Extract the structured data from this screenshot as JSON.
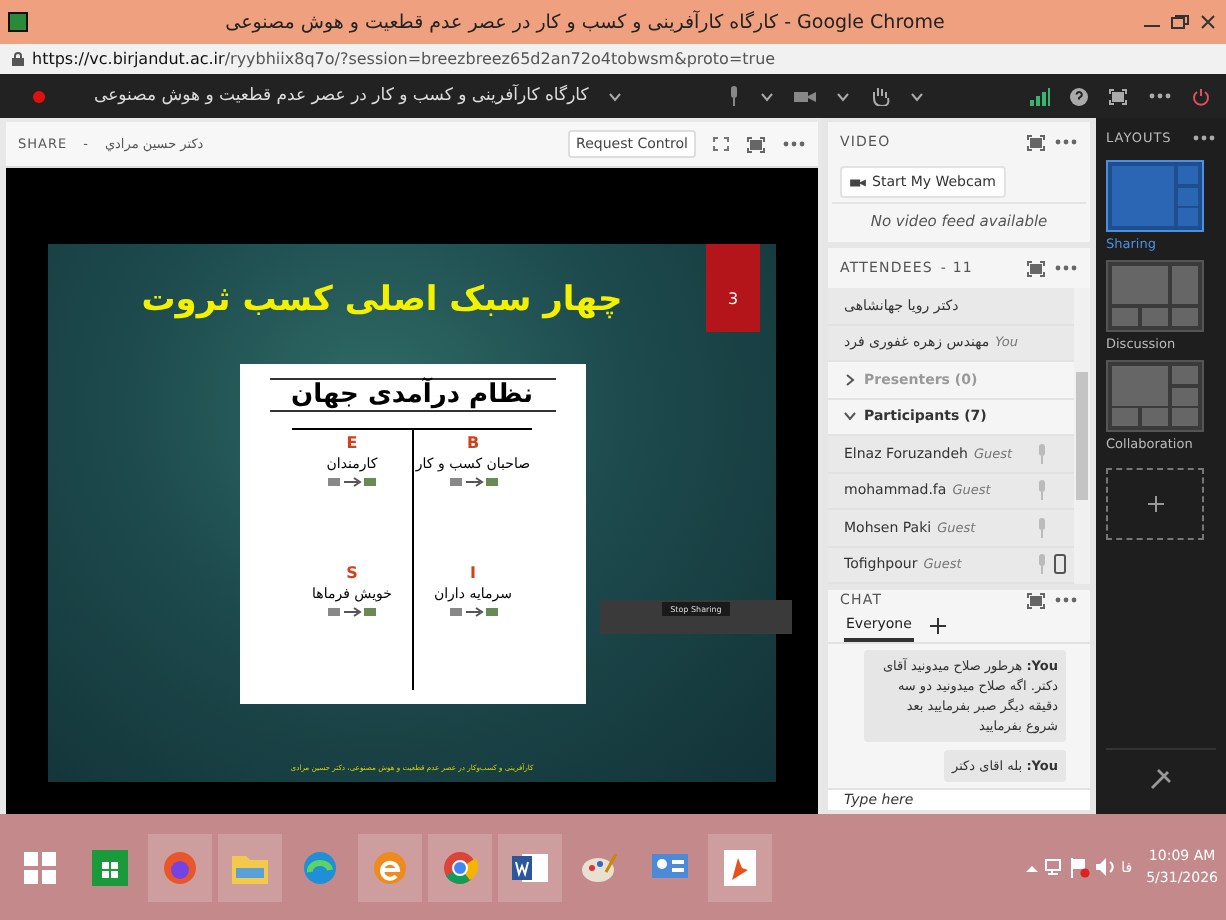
{
  "browser": {
    "title": "کارگاه کارآفرینی و کسب و کار در عصر عدم قطعیت و هوش مصنوعی - Google Chrome",
    "url_host": "https://vc.birjandut.ac.ir",
    "url_path": "/ryybhiix8q7o/?session=breezbreez65d2an72o4tobwsm&proto=true"
  },
  "toolbar": {
    "recording": true,
    "meeting_title": "کارگاه کارآفرینی و کسب و کار در عصر عدم قطعیت و هوش مصنوعی"
  },
  "share": {
    "label": "SHARE",
    "separator": "-",
    "presenter": "دکتر حسين مرادي",
    "request_control": "Request Control"
  },
  "slide": {
    "title": "چهار سبک اصلی کسب ثروت",
    "number": "3",
    "image_title": "نظام درآمدی جهان",
    "quadrants": [
      {
        "letter": "B",
        "label": "صاحبان کسب و کار"
      },
      {
        "letter": "E",
        "label": "کارمندان"
      },
      {
        "letter": "I",
        "label": "سرمایه داران"
      },
      {
        "letter": "S",
        "label": "خویش فرماها"
      }
    ],
    "footer": "کارآفرینی و کسب‌وکار  در عصر عدم قطعیت و هوش مصنوعی، دکتر حسین مرادی"
  },
  "stop_sharing": "Stop Sharing",
  "video": {
    "title": "VIDEO",
    "button": "Start My Webcam",
    "empty": "No video feed available"
  },
  "attendees": {
    "title": "ATTENDEES",
    "count": "- 11",
    "hosts": [
      {
        "name": "دکتر رویا جهانشاهی"
      },
      {
        "name": "مهندس زهره غفوری فرد",
        "tag": "You"
      }
    ],
    "groups": [
      {
        "label": "Presenters (0)",
        "expanded": false
      },
      {
        "label": "Participants (7)",
        "expanded": true,
        "members": [
          {
            "name": "Elnaz Foruzandeh",
            "role": "Guest",
            "mobile": false
          },
          {
            "name": "mohammad.fa",
            "role": "Guest",
            "mobile": false
          },
          {
            "name": "Mohsen Paki",
            "role": "Guest",
            "mobile": false
          },
          {
            "name": "Tofighpour",
            "role": "Guest",
            "mobile": true
          }
        ]
      }
    ]
  },
  "chat": {
    "title": "CHAT",
    "tabs": [
      {
        "label": "Everyone",
        "selected": true
      }
    ],
    "messages": [
      {
        "sender": "You:",
        "text": "هرطور صلاح میدونید آقای دکتر. اگه صلاح میدونید دو سه دقیقه دیگر صبر بفرمایید بعد شروع بفرمایید"
      },
      {
        "sender": "You:",
        "text": "بله اقای دکتر"
      }
    ],
    "placeholder": "Type here"
  },
  "layouts": {
    "title": "LAYOUTS",
    "items": [
      {
        "label": "Sharing",
        "kind": "sharing",
        "selected": true
      },
      {
        "label": "Discussion",
        "kind": "discussion",
        "selected": false
      },
      {
        "label": "Collaboration",
        "kind": "collaboration",
        "selected": false
      }
    ]
  },
  "taskbar": {
    "language": "فا",
    "time": "10:09 AM",
    "date": "5/31/2026"
  }
}
